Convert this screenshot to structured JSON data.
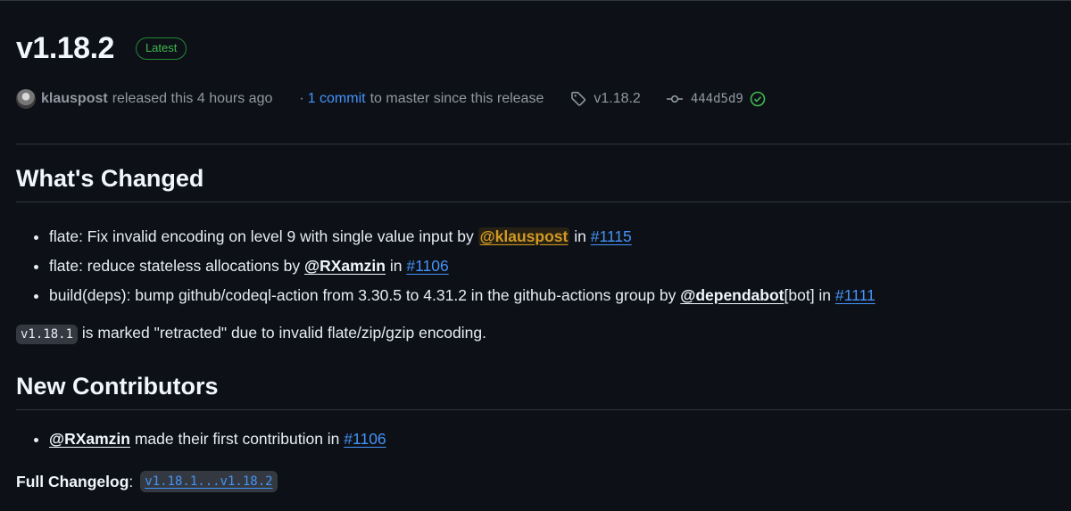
{
  "release": {
    "title": "v1.18.2",
    "latest_badge": "Latest"
  },
  "meta": {
    "author": "klauspost",
    "released_text": "released this 4 hours ago",
    "separator": "·",
    "commit_count": "1 commit",
    "commit_suffix": "to master since this release",
    "tag": "v1.18.2",
    "commit_hash": "444d5d9"
  },
  "whats_changed": {
    "heading": "What's Changed",
    "items": [
      {
        "text": "flate: Fix invalid encoding on level 9 with single value input by",
        "mention": "@klauspost",
        "in": "in",
        "issue": "#1115"
      },
      {
        "text": "flate: reduce stateless allocations by",
        "mention": "@RXamzin",
        "in": "in",
        "issue": "#1106"
      },
      {
        "text": "build(deps): bump github/codeql-action from 3.30.5 to 4.31.2 in the github-actions group by",
        "mention": "@dependabot",
        "suffix": "[bot] in",
        "issue": "#1111"
      }
    ]
  },
  "note": {
    "code": "v1.18.1",
    "text": "is marked \"retracted\" due to invalid flate/zip/gzip encoding."
  },
  "new_contributors": {
    "heading": "New Contributors",
    "items": [
      {
        "mention": "@RXamzin",
        "text": "made their first contribution in",
        "issue": "#1106"
      }
    ]
  },
  "full_changelog": {
    "label": "Full Changelog",
    "colon": ":",
    "link": "v1.18.1...v1.18.2"
  },
  "colors": {
    "background": "#0d1117",
    "link": "#4493f8",
    "success": "#3fb950",
    "highlight": "#d29922"
  },
  "icons": {
    "tag": "tag-icon",
    "commit": "git-commit-icon",
    "verified": "check-circle-icon",
    "avatar": "avatar"
  }
}
